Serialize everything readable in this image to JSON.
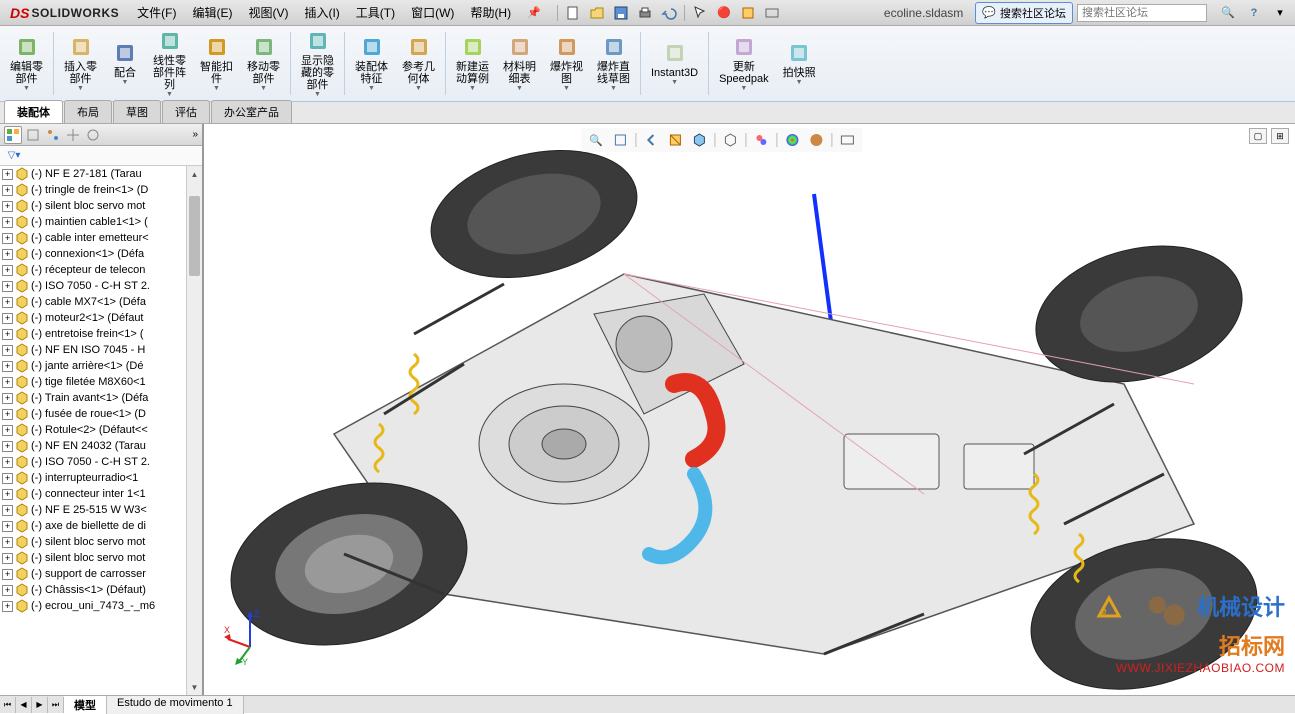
{
  "app": {
    "logo_text": "SOLIDWORKS",
    "logo_ds": "DS"
  },
  "menu": [
    "文件(F)",
    "编辑(E)",
    "视图(V)",
    "插入(I)",
    "工具(T)",
    "窗口(W)",
    "帮助(H)"
  ],
  "document_name": "ecoline.sldasm",
  "forum_button": "搜索社区论坛",
  "search_placeholder": "搜索社区论坛",
  "help_tooltip": "?",
  "ribbon": [
    {
      "label": "编辑零\n部件",
      "icon": "edit-component-icon",
      "color": "#6aa84f"
    },
    {
      "label": "插入零\n部件",
      "icon": "insert-component-icon",
      "color": "#d4a84a"
    },
    {
      "label": "配合",
      "icon": "mate-icon",
      "color": "#46a"
    },
    {
      "label": "线性零\n部件阵\n列",
      "icon": "linear-pattern-icon",
      "color": "#4a9"
    },
    {
      "label": "智能扣\n件",
      "icon": "smart-fastener-icon",
      "color": "#c80"
    },
    {
      "label": "移动零\n部件",
      "icon": "move-component-icon",
      "color": "#6a6"
    },
    {
      "label": "显示隐\n藏的零\n部件",
      "icon": "show-hidden-icon",
      "color": "#4aa"
    },
    {
      "label": "装配体\n特征",
      "icon": "assembly-feature-icon",
      "color": "#39c"
    },
    {
      "label": "参考几\n何体",
      "icon": "reference-geom-icon",
      "color": "#c93"
    },
    {
      "label": "新建运\n动算例",
      "icon": "motion-study-icon",
      "color": "#9c4"
    },
    {
      "label": "材料明\n细表",
      "icon": "bom-icon",
      "color": "#c96"
    },
    {
      "label": "爆炸视\n图",
      "icon": "exploded-view-icon",
      "color": "#c84"
    },
    {
      "label": "爆炸直\n线草图",
      "icon": "explode-line-icon",
      "color": "#58b"
    },
    {
      "label": "Instant3D",
      "icon": "instant3d-icon",
      "color": "#bca"
    },
    {
      "label": "更新\nSpeedpak",
      "icon": "speedpak-icon",
      "color": "#b9c"
    },
    {
      "label": "拍快照",
      "icon": "snapshot-icon",
      "color": "#6bc"
    }
  ],
  "tabs": [
    "装配体",
    "布局",
    "草图",
    "评估",
    "办公室产品"
  ],
  "active_tab": 0,
  "tree": {
    "items": [
      "(-) ecrou_uni_7473_-_m6",
      "(-) Châssis<1> (Défaut)",
      "(-) support de carrosser",
      "(-) silent bloc servo mot",
      "(-) silent bloc servo mot",
      "(-) axe de biellette de di",
      "(-) NF E 25-515  W W3<",
      "(-) connecteur inter 1<1",
      "(-) interrupteurradio<1",
      "(-) ISO 7050 - C-H ST 2.",
      "(-) NF EN 24032  (Tarau",
      "(-) Rotule<2> (Défaut<<",
      "(-) fusée de roue<1> (D",
      "(-) Train avant<1> (Défa",
      "(-) tige filetée M8X60<1",
      "(-) jante arrière<1> (Dé",
      "(-) NF EN ISO 7045 - H",
      "(-) entretoise frein<1> (",
      "(-) moteur2<1> (Défaut",
      "(-) cable MX7<1> (Défa",
      "(-) ISO 7050 - C-H ST 2.",
      "(-) récepteur de telecon",
      "(-) connexion<1> (Défa",
      "(-) cable inter emetteur<",
      "(-) maintien cable1<1> (",
      "(-) silent bloc servo mot",
      "(-) tringle de frein<1> (D",
      "(-) NF E 27-181  (Tarau"
    ]
  },
  "bottom_tabs": [
    "模型",
    "Estudo de movimento 1"
  ],
  "active_bottom_tab": 0,
  "watermark": {
    "brand_blue": "机械设计",
    "brand_orange": "招标网",
    "url": "WWW.JIXIEZHAOBIAO.COM"
  },
  "triad": {
    "x": "X",
    "y": "Y",
    "z": "Z"
  }
}
